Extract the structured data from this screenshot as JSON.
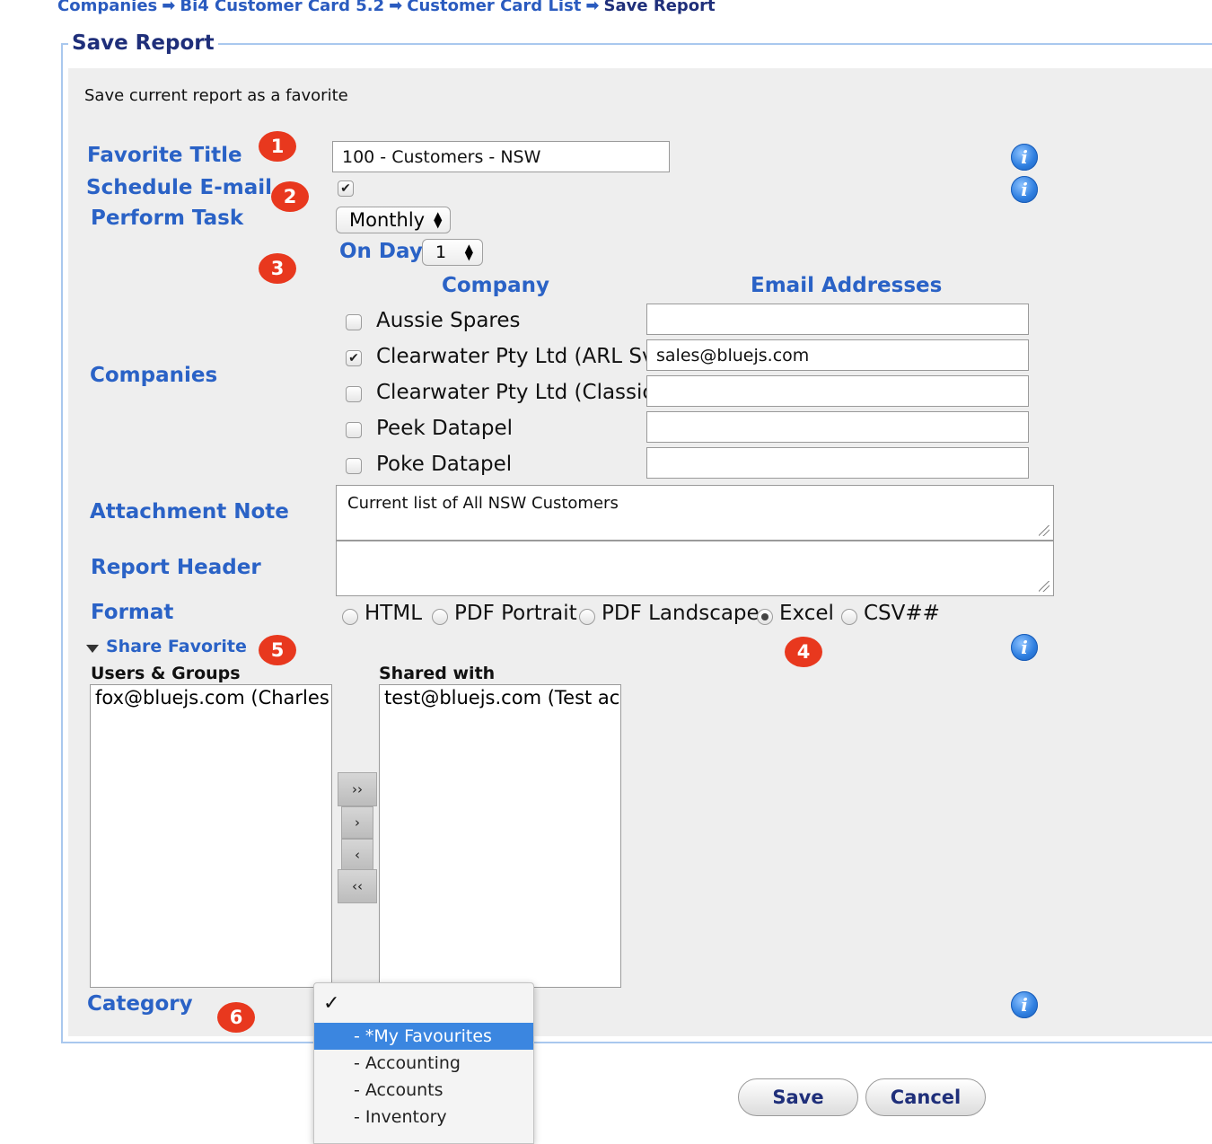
{
  "breadcrumb": {
    "items": [
      "Companies",
      "Bi4 Customer Card 5.2",
      "Customer Card List"
    ],
    "current": "Save Report",
    "separator": "➡"
  },
  "form": {
    "legend": "Save Report",
    "description": "Save current report as a favorite",
    "favorite_title": {
      "label": "Favorite Title",
      "value": "100 - Customers - NSW"
    },
    "schedule_email": {
      "label": "Schedule E-mail",
      "checked": true
    },
    "perform_task": {
      "label": "Perform Task",
      "value": "Monthly"
    },
    "on_day": {
      "label": "On Day",
      "value": "1"
    },
    "companies": {
      "label": "Companies",
      "col_company": "Company",
      "col_email": "Email Addresses",
      "rows": [
        {
          "name": "Aussie Spares",
          "checked": false,
          "email": ""
        },
        {
          "name": "Clearwater Pty Ltd (ARL Svr)",
          "checked": true,
          "email": "sales@bluejs.com"
        },
        {
          "name": "Clearwater Pty Ltd (Classic)",
          "checked": false,
          "email": ""
        },
        {
          "name": "Peek Datapel",
          "checked": false,
          "email": ""
        },
        {
          "name": "Poke Datapel",
          "checked": false,
          "email": ""
        }
      ]
    },
    "attachment_note": {
      "label": "Attachment Note",
      "value": "Current list of All NSW Customers"
    },
    "report_header": {
      "label": "Report Header",
      "value": ""
    },
    "format": {
      "label": "Format",
      "options": [
        "HTML",
        "PDF Portrait",
        "PDF Landscape",
        "Excel",
        "CSV##"
      ],
      "selected": "Excel"
    },
    "share": {
      "toggle_label": "Share Favorite",
      "users_label": "Users & Groups",
      "users": [
        "fox@bluejs.com (Charles Fox)"
      ],
      "shared_label": "Shared with",
      "shared": [
        "test@bluejs.com (Test account)"
      ],
      "buttons": {
        "add_all": "››",
        "add": "›",
        "remove": "‹",
        "remove_all": "‹‹"
      }
    },
    "category": {
      "label": "Category",
      "checkmark": "✓",
      "options": [
        "- *My Favourites",
        "- Accounting",
        "- Accounts",
        "- Inventory"
      ],
      "highlighted": "- *My Favourites"
    },
    "info_glyph": "i"
  },
  "badges": [
    "1",
    "2",
    "3",
    "4",
    "5",
    "6"
  ],
  "actions": {
    "save": "Save",
    "cancel": "Cancel"
  },
  "colors": {
    "label_blue": "#2a62c6",
    "title_navy": "#1f2f7a",
    "badge_red": "#e8381e",
    "highlight": "#3b86e0"
  }
}
